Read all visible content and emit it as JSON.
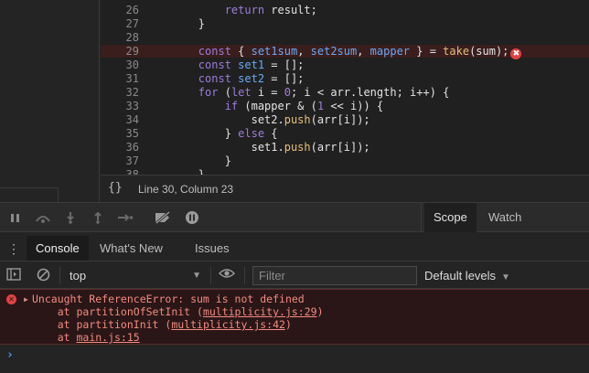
{
  "editor": {
    "lines": [
      {
        "num": "26",
        "segments": [
          {
            "t": "            "
          },
          {
            "t": "return",
            "c": "kw"
          },
          {
            "t": " result;"
          }
        ]
      },
      {
        "num": "27",
        "segments": [
          {
            "t": "        }"
          }
        ]
      },
      {
        "num": "28",
        "segments": [
          {
            "t": ""
          }
        ]
      },
      {
        "num": "29",
        "error": true,
        "segments": [
          {
            "t": "        "
          },
          {
            "t": "const",
            "c": "kw"
          },
          {
            "t": " { "
          },
          {
            "t": "set1sum",
            "c": "var"
          },
          {
            "t": ", "
          },
          {
            "t": "set2sum",
            "c": "var"
          },
          {
            "t": ", "
          },
          {
            "t": "mapper",
            "c": "var"
          },
          {
            "t": " } = "
          },
          {
            "t": "take",
            "c": "fn"
          },
          {
            "t": "(sum);"
          }
        ]
      },
      {
        "num": "30",
        "segments": [
          {
            "t": "        "
          },
          {
            "t": "const",
            "c": "kw"
          },
          {
            "t": " "
          },
          {
            "t": "set1",
            "c": "var"
          },
          {
            "t": " = [];"
          }
        ]
      },
      {
        "num": "31",
        "segments": [
          {
            "t": "        "
          },
          {
            "t": "const",
            "c": "kw"
          },
          {
            "t": " "
          },
          {
            "t": "set2",
            "c": "var"
          },
          {
            "t": " = [];"
          }
        ]
      },
      {
        "num": "32",
        "segments": [
          {
            "t": "        "
          },
          {
            "t": "for",
            "c": "kw"
          },
          {
            "t": " ("
          },
          {
            "t": "let",
            "c": "kw"
          },
          {
            "t": " i = "
          },
          {
            "t": "0",
            "c": "num"
          },
          {
            "t": "; i < arr.length; i++) {"
          }
        ]
      },
      {
        "num": "33",
        "segments": [
          {
            "t": "            "
          },
          {
            "t": "if",
            "c": "kw"
          },
          {
            "t": " (mapper & ("
          },
          {
            "t": "1",
            "c": "num"
          },
          {
            "t": " << i)) {"
          }
        ]
      },
      {
        "num": "34",
        "segments": [
          {
            "t": "                set2."
          },
          {
            "t": "push",
            "c": "fn"
          },
          {
            "t": "(arr[i]);"
          }
        ]
      },
      {
        "num": "35",
        "segments": [
          {
            "t": "            } "
          },
          {
            "t": "else",
            "c": "kw"
          },
          {
            "t": " {"
          }
        ]
      },
      {
        "num": "36",
        "segments": [
          {
            "t": "                set1."
          },
          {
            "t": "push",
            "c": "fn"
          },
          {
            "t": "(arr[i]);"
          }
        ]
      },
      {
        "num": "37",
        "segments": [
          {
            "t": "            }"
          }
        ]
      },
      {
        "num": "38",
        "segments": [
          {
            "t": "        }"
          }
        ]
      }
    ],
    "error_badge": "✖"
  },
  "status": {
    "braces": "{}",
    "position": "Line 30, Column 23"
  },
  "debugger": {
    "icons": [
      "pause-icon",
      "step-over-icon",
      "step-into-icon",
      "step-out-icon",
      "step-icon",
      "deactivate-breakpoints-icon",
      "pause-on-exceptions-icon"
    ],
    "tabs": [
      {
        "label": "Scope",
        "active": true
      },
      {
        "label": "Watch",
        "active": false
      }
    ]
  },
  "drawer": {
    "menu_icon": "⋮",
    "tabs": [
      {
        "label": "Console",
        "active": true
      },
      {
        "label": "What's New",
        "active": false
      },
      {
        "label": "Issues",
        "active": false
      }
    ]
  },
  "console_toolbar": {
    "context": "top",
    "filter_placeholder": "Filter",
    "filter_value": "",
    "levels": "Default levels"
  },
  "console": {
    "messages": [
      {
        "level": "error",
        "text": "Uncaught ReferenceError: sum is not defined",
        "stack": [
          {
            "prefix": "    at partitionOfSetInit (",
            "link": "multiplicity.js:29",
            "suffix": ")"
          },
          {
            "prefix": "    at partitionInit (",
            "link": "multiplicity.js:42",
            "suffix": ")"
          },
          {
            "prefix": "    at ",
            "link": "main.js:15",
            "suffix": ""
          }
        ]
      }
    ],
    "prompt": "›"
  },
  "colors": {
    "error_text": "#f28b82",
    "error_bg": "#2a1616",
    "accent_blue": "#4c9be8",
    "keyword": "#9d7cd8",
    "function": "#e5c07b",
    "variable": "#6aa9f4"
  }
}
